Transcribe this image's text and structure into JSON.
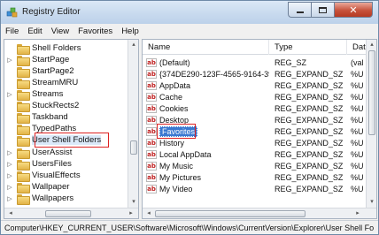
{
  "window": {
    "title": "Registry Editor",
    "caption": {
      "minimize": "minimize",
      "maximize": "maximize",
      "close": "✕"
    }
  },
  "menu": [
    "File",
    "Edit",
    "View",
    "Favorites",
    "Help"
  ],
  "tree": [
    {
      "label": "Shell Folders",
      "expander": ""
    },
    {
      "label": "StartPage",
      "expander": "▷"
    },
    {
      "label": "StartPage2",
      "expander": ""
    },
    {
      "label": "StreamMRU",
      "expander": ""
    },
    {
      "label": "Streams",
      "expander": "▷"
    },
    {
      "label": "StuckRects2",
      "expander": ""
    },
    {
      "label": "Taskband",
      "expander": ""
    },
    {
      "label": "TypedPaths",
      "expander": ""
    },
    {
      "label": "User Shell Folders",
      "expander": "",
      "selected": true
    },
    {
      "label": "UserAssist",
      "expander": "▷"
    },
    {
      "label": "UsersFiles",
      "expander": "▷"
    },
    {
      "label": "VisualEffects",
      "expander": "▷"
    },
    {
      "label": "Wallpaper",
      "expander": "▷"
    },
    {
      "label": "Wallpapers",
      "expander": "▷"
    }
  ],
  "columns": {
    "name": "Name",
    "type": "Type",
    "data": "Data"
  },
  "values": [
    {
      "name": "(Default)",
      "type": "REG_SZ",
      "data": "(val"
    },
    {
      "name": "{374DE290-123F-4565-9164-39...",
      "type": "REG_EXPAND_SZ",
      "data": "%U"
    },
    {
      "name": "AppData",
      "type": "REG_EXPAND_SZ",
      "data": "%U"
    },
    {
      "name": "Cache",
      "type": "REG_EXPAND_SZ",
      "data": "%U"
    },
    {
      "name": "Cookies",
      "type": "REG_EXPAND_SZ",
      "data": "%U"
    },
    {
      "name": "Desktop",
      "type": "REG_EXPAND_SZ",
      "data": "%U"
    },
    {
      "name": "Favorites",
      "type": "REG_EXPAND_SZ",
      "data": "%U",
      "selected": true
    },
    {
      "name": "History",
      "type": "REG_EXPAND_SZ",
      "data": "%U"
    },
    {
      "name": "Local AppData",
      "type": "REG_EXPAND_SZ",
      "data": "%U"
    },
    {
      "name": "My Music",
      "type": "REG_EXPAND_SZ",
      "data": "%U"
    },
    {
      "name": "My Pictures",
      "type": "REG_EXPAND_SZ",
      "data": "%U"
    },
    {
      "name": "My Video",
      "type": "REG_EXPAND_SZ",
      "data": "%U"
    }
  ],
  "value_icon": "ab",
  "status": "Computer\\HKEY_CURRENT_USER\\Software\\Microsoft\\Windows\\CurrentVersion\\Explorer\\User Shell Fo",
  "scroll": {
    "left_arrow": "◂",
    "right_arrow": "▸",
    "up_arrow": "▴",
    "down_arrow": "▾",
    "thumb_grip": "|||"
  },
  "colors": {
    "highlight_box": "#dd2222",
    "selection": "#3a78d0"
  }
}
